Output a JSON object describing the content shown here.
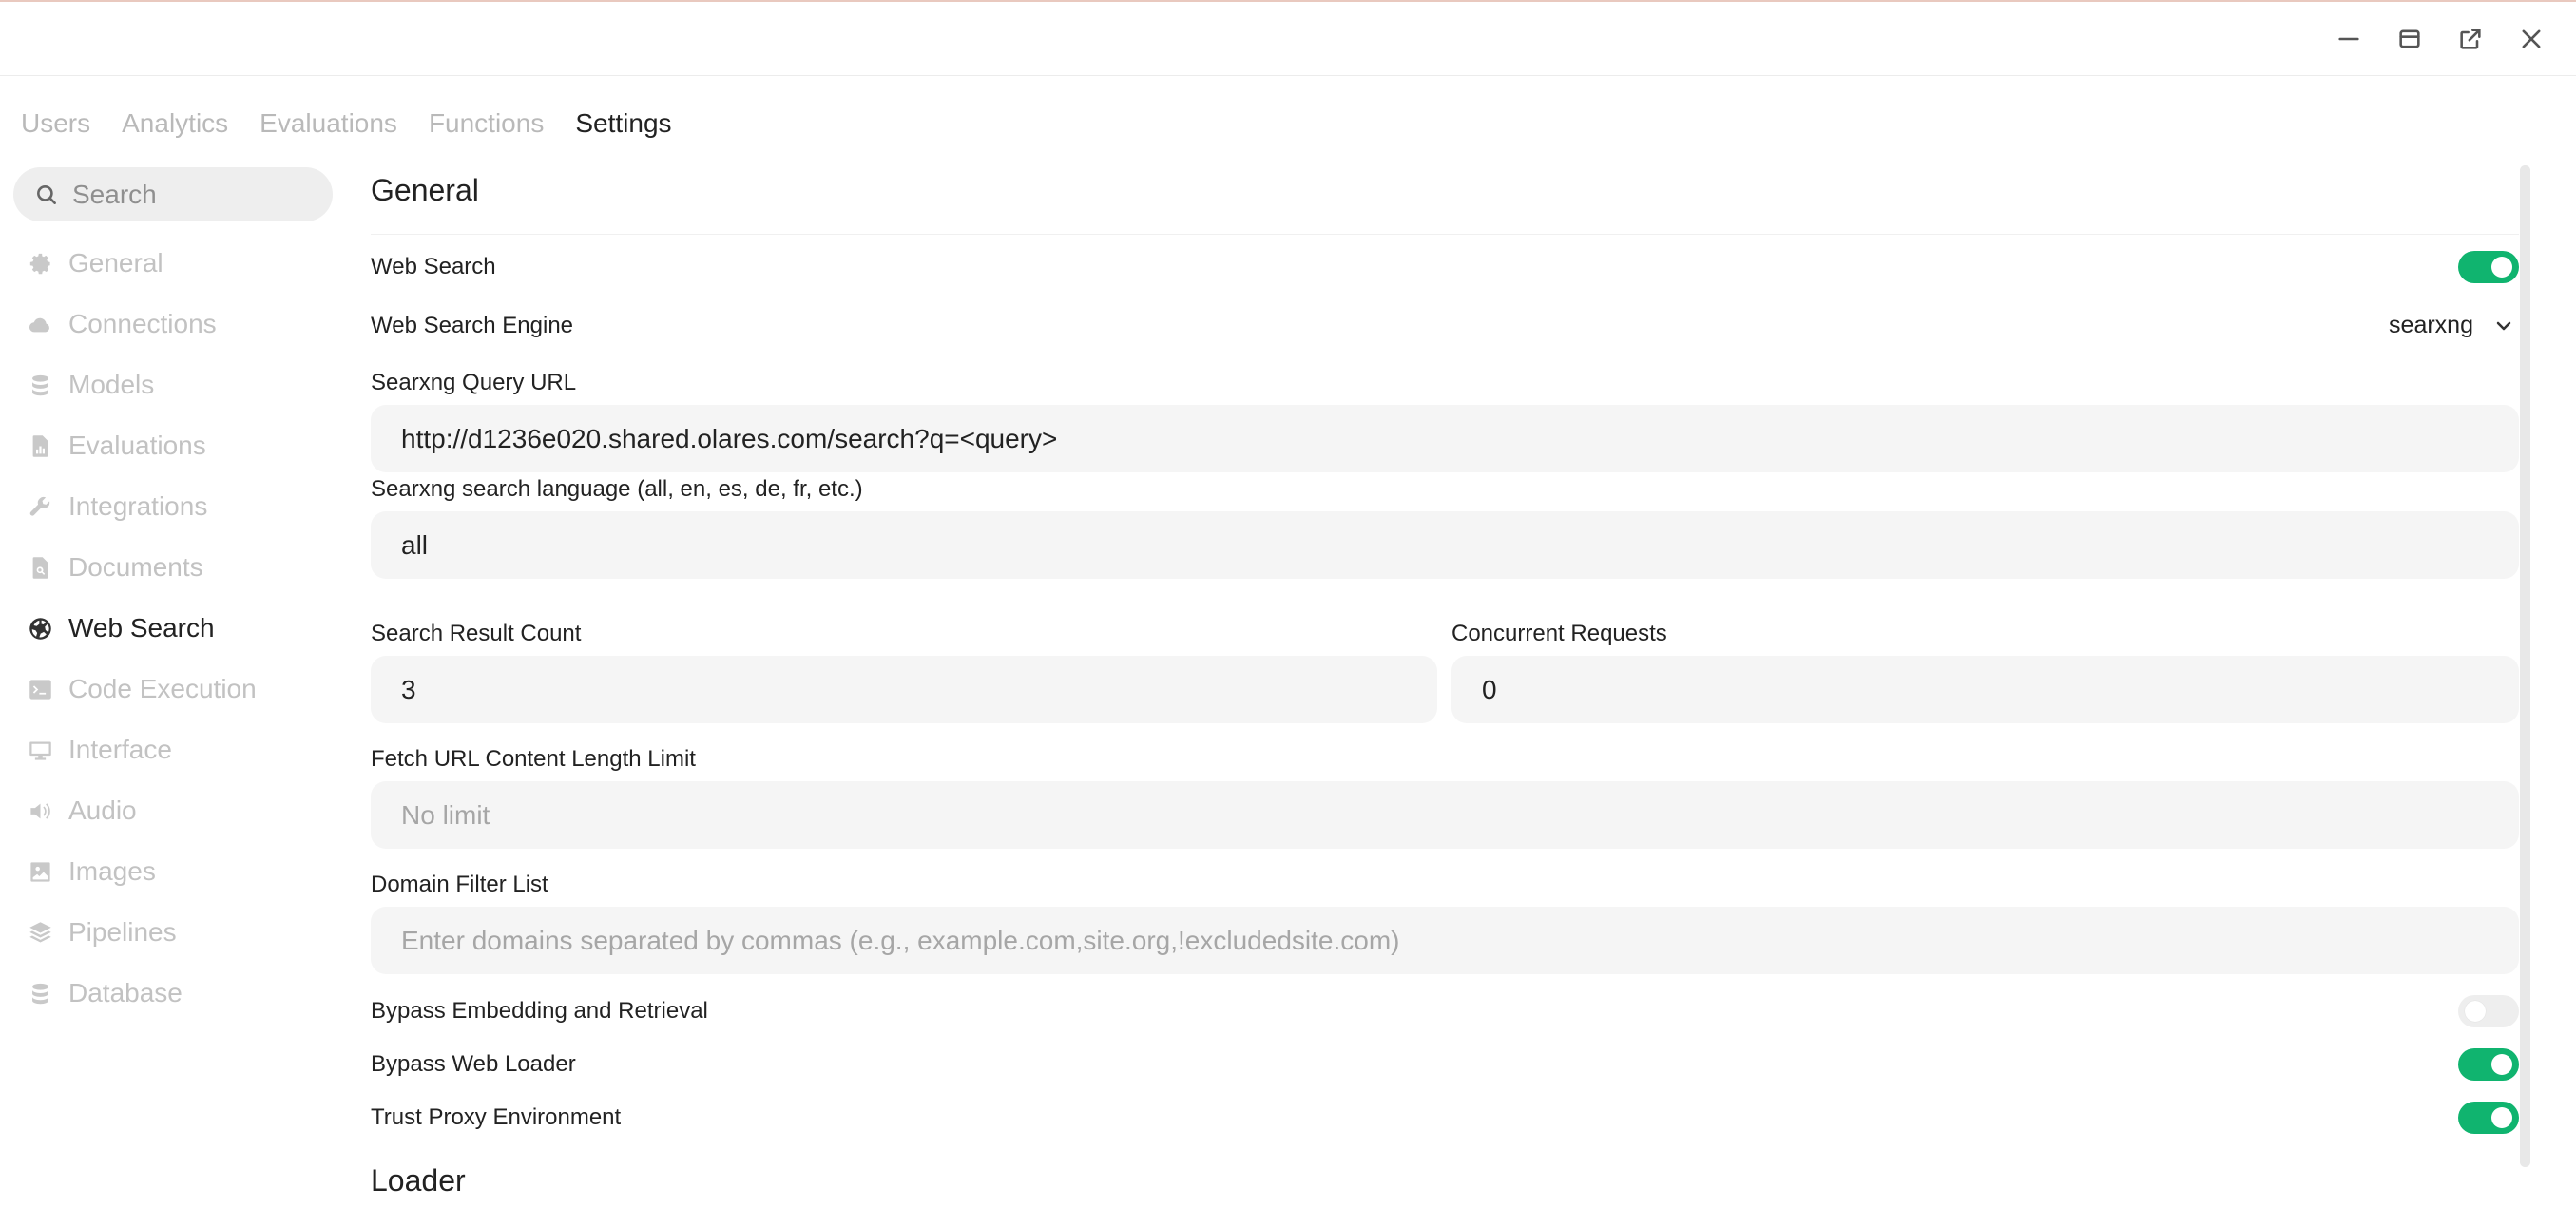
{
  "window": {
    "controls": {
      "minimize_icon": "minimize-icon",
      "maximize_icon": "maximize-icon",
      "popout_icon": "popout-icon",
      "close_icon": "close-icon"
    }
  },
  "tabs": [
    {
      "label": "Users"
    },
    {
      "label": "Analytics"
    },
    {
      "label": "Evaluations"
    },
    {
      "label": "Functions"
    },
    {
      "label": "Settings",
      "active": true
    }
  ],
  "sidebar": {
    "search_placeholder": "Search",
    "items": [
      {
        "label": "General",
        "icon": "gear-icon"
      },
      {
        "label": "Connections",
        "icon": "cloud-icon"
      },
      {
        "label": "Models",
        "icon": "database-icon"
      },
      {
        "label": "Evaluations",
        "icon": "document-chart-icon"
      },
      {
        "label": "Integrations",
        "icon": "wrench-icon"
      },
      {
        "label": "Documents",
        "icon": "document-search-icon"
      },
      {
        "label": "Web Search",
        "icon": "globe-icon",
        "active": true
      },
      {
        "label": "Code Execution",
        "icon": "terminal-icon"
      },
      {
        "label": "Interface",
        "icon": "monitor-icon"
      },
      {
        "label": "Audio",
        "icon": "speaker-icon"
      },
      {
        "label": "Images",
        "icon": "image-icon"
      },
      {
        "label": "Pipelines",
        "icon": "layers-icon"
      },
      {
        "label": "Database",
        "icon": "database-icon"
      }
    ]
  },
  "general": {
    "title": "General",
    "web_search": {
      "label": "Web Search",
      "enabled": true
    },
    "engine": {
      "label": "Web Search Engine",
      "value": "searxng"
    },
    "query_url": {
      "label": "Searxng Query URL",
      "value": "http://d1236e020.shared.olares.com/search?q=<query>"
    },
    "language": {
      "label": "Searxng search language (all, en, es, de, fr, etc.)",
      "value": "all"
    },
    "result_count": {
      "label": "Search Result Count",
      "value": "3"
    },
    "concurrent": {
      "label": "Concurrent Requests",
      "value": "0"
    },
    "fetch_limit": {
      "label": "Fetch URL Content Length Limit",
      "placeholder": "No limit"
    },
    "domain_filter": {
      "label": "Domain Filter List",
      "placeholder": "Enter domains separated by commas (e.g., example.com,site.org,!excludedsite.com)"
    },
    "bypass_embedding": {
      "label": "Bypass Embedding and Retrieval",
      "enabled": false
    },
    "bypass_loader": {
      "label": "Bypass Web Loader",
      "enabled": true
    },
    "trust_proxy": {
      "label": "Trust Proxy Environment",
      "enabled": true
    }
  },
  "loader": {
    "title": "Loader"
  },
  "colors": {
    "accent": "#10b46f",
    "muted_text": "#c2c2c2",
    "field_bg": "#f5f5f5"
  }
}
